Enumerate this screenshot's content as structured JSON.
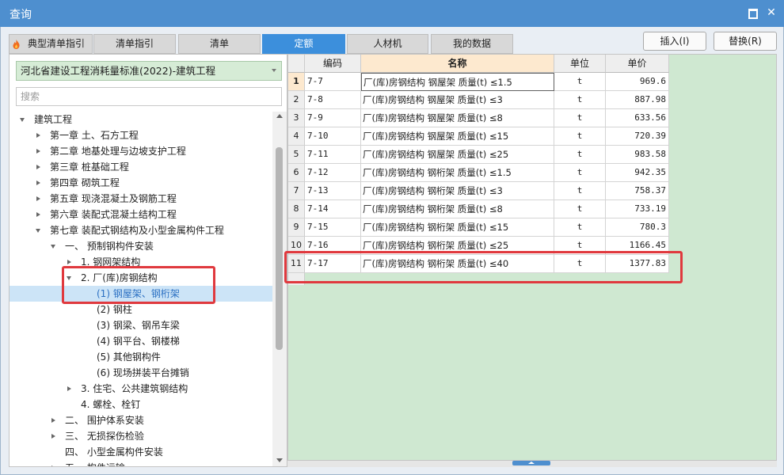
{
  "window": {
    "title": "查询",
    "maximize_icon": "maximize-icon",
    "close_icon": "close-icon",
    "close_glyph": "✕"
  },
  "tabs": [
    {
      "label": "典型清单指引",
      "active": false,
      "icon": "flame-icon"
    },
    {
      "label": "清单指引",
      "active": false
    },
    {
      "label": "清单",
      "active": false
    },
    {
      "label": "定额",
      "active": true
    },
    {
      "label": "人材机",
      "active": false
    },
    {
      "label": "我的数据",
      "active": false
    }
  ],
  "actions": {
    "insert_label": "插入(I)",
    "replace_label": "替换(R)"
  },
  "left": {
    "library_select": "河北省建设工程消耗量标准(2022)-建筑工程",
    "search_placeholder": "搜索",
    "tree": [
      {
        "label": "建筑工程",
        "level": 0,
        "toggle": "down"
      },
      {
        "label": "第一章 土、石方工程",
        "level": 1,
        "toggle": "right"
      },
      {
        "label": "第二章 地基处理与边坡支护工程",
        "level": 1,
        "toggle": "right"
      },
      {
        "label": "第三章 桩基础工程",
        "level": 1,
        "toggle": "right"
      },
      {
        "label": "第四章 砌筑工程",
        "level": 1,
        "toggle": "right"
      },
      {
        "label": "第五章 现浇混凝土及钢筋工程",
        "level": 1,
        "toggle": "right"
      },
      {
        "label": "第六章 装配式混凝土结构工程",
        "level": 1,
        "toggle": "right"
      },
      {
        "label": "第七章 装配式钢结构及小型金属构件工程",
        "level": 1,
        "toggle": "down"
      },
      {
        "label": "一、 预制钢构件安装",
        "level": 2,
        "toggle": "down"
      },
      {
        "label": "1. 钢网架结构",
        "level": 3,
        "toggle": "right"
      },
      {
        "label": "2. 厂(库)房钢结构",
        "level": 3,
        "toggle": "down"
      },
      {
        "label": "(1) 钢屋架、钢桁架",
        "level": 4,
        "toggle": "none",
        "selected": true
      },
      {
        "label": "(2) 钢柱",
        "level": 4,
        "toggle": "none"
      },
      {
        "label": "(3) 钢梁、钢吊车梁",
        "level": 4,
        "toggle": "none"
      },
      {
        "label": "(4) 钢平台、钢楼梯",
        "level": 4,
        "toggle": "none"
      },
      {
        "label": "(5) 其他钢构件",
        "level": 4,
        "toggle": "none"
      },
      {
        "label": "(6) 现场拼装平台摊销",
        "level": 4,
        "toggle": "none"
      },
      {
        "label": "3. 住宅、公共建筑钢结构",
        "level": 3,
        "toggle": "right"
      },
      {
        "label": "4. 螺栓、栓钉",
        "level": 3,
        "toggle": "none"
      },
      {
        "label": "二、 围护体系安装",
        "level": 2,
        "toggle": "right"
      },
      {
        "label": "三、 无损探伤检验",
        "level": 2,
        "toggle": "right"
      },
      {
        "label": "四、 小型金属构件安装",
        "level": 2,
        "toggle": "none"
      },
      {
        "label": "五、 构件运输",
        "level": 2,
        "toggle": "right"
      }
    ]
  },
  "grid": {
    "columns": [
      "编码",
      "名称",
      "单位",
      "单价"
    ],
    "rows": [
      {
        "no": "1",
        "code": "7-7",
        "name": "厂(库)房钢结构 钢屋架 质量(t) ≤1.5",
        "unit": "t",
        "price": "969.6"
      },
      {
        "no": "2",
        "code": "7-8",
        "name": "厂(库)房钢结构 钢屋架 质量(t) ≤3",
        "unit": "t",
        "price": "887.98"
      },
      {
        "no": "3",
        "code": "7-9",
        "name": "厂(库)房钢结构 钢屋架 质量(t) ≤8",
        "unit": "t",
        "price": "633.56"
      },
      {
        "no": "4",
        "code": "7-10",
        "name": "厂(库)房钢结构 钢屋架 质量(t) ≤15",
        "unit": "t",
        "price": "720.39"
      },
      {
        "no": "5",
        "code": "7-11",
        "name": "厂(库)房钢结构 钢屋架 质量(t) ≤25",
        "unit": "t",
        "price": "983.58"
      },
      {
        "no": "6",
        "code": "7-12",
        "name": "厂(库)房钢结构 钢桁架 质量(t) ≤1.5",
        "unit": "t",
        "price": "942.35"
      },
      {
        "no": "7",
        "code": "7-13",
        "name": "厂(库)房钢结构 钢桁架 质量(t) ≤3",
        "unit": "t",
        "price": "758.37"
      },
      {
        "no": "8",
        "code": "7-14",
        "name": "厂(库)房钢结构 钢桁架 质量(t) ≤8",
        "unit": "t",
        "price": "733.19"
      },
      {
        "no": "9",
        "code": "7-15",
        "name": "厂(库)房钢结构 钢桁架 质量(t) ≤15",
        "unit": "t",
        "price": "780.3"
      },
      {
        "no": "10",
        "code": "7-16",
        "name": "厂(库)房钢结构 钢桁架 质量(t) ≤25",
        "unit": "t",
        "price": "1166.45"
      },
      {
        "no": "11",
        "code": "7-17",
        "name": "厂(库)房钢结构 钢桁架 质量(t) ≤40",
        "unit": "t",
        "price": "1377.83"
      }
    ]
  },
  "colors": {
    "titlebar": "#4e8fcf",
    "active_tab": "#3c8fdc",
    "highlight_box": "#e0393e",
    "selected_node": "#cce4f7",
    "grid_background": "#cfe8d1"
  }
}
